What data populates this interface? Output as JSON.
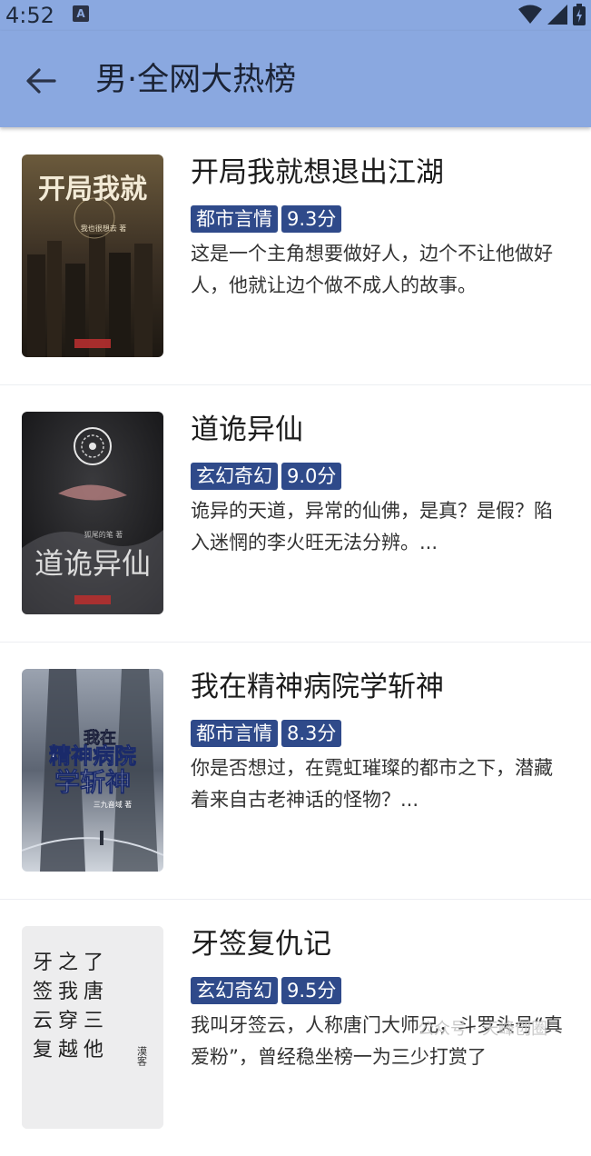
{
  "status_bar": {
    "time": "4:52"
  },
  "app_bar": {
    "title": "男·全网大热榜"
  },
  "books": [
    {
      "title": "开局我就想退出江湖",
      "genre": "都市言情",
      "score": "9.3分",
      "description": "这是一个主角想要做好人，边个不让他做好人，他就让边个做不成人的故事。",
      "cover_text": "开局我就",
      "cover_author": "我也很想去 著"
    },
    {
      "title": "道诡异仙",
      "genre": "玄幻奇幻",
      "score": "9.0分",
      "description": "诡异的天道，异常的仙佛，是真？是假？陷入迷惘的李火旺无法分辨。...",
      "cover_text": "道诡异仙",
      "cover_author": "狐尾的笔 著"
    },
    {
      "title": "我在精神病院学斩神",
      "genre": "都市言情",
      "score": "8.3分",
      "description": "你是否想过，在霓虹璀璨的都市之下，潜藏着来自古老神话的怪物？...",
      "cover_text_top": "我在",
      "cover_text_mid": "精神病院",
      "cover_text_bottom": "学斩神",
      "cover_author": "三九音域 著"
    },
    {
      "title": "牙签复仇记",
      "genre": "玄幻奇幻",
      "score": "9.5分",
      "description": "我叫牙签云，人称唐门大师兄，斗罗头号“真爱粉”，曾经稳坐榜一为三少打赏了",
      "cover_lines": [
        "牙之了",
        "签我唐",
        "云穿三",
        "复越他"
      ],
      "cover_side": "漠客"
    }
  ],
  "watermark": "公众号 · 天峰创圈"
}
